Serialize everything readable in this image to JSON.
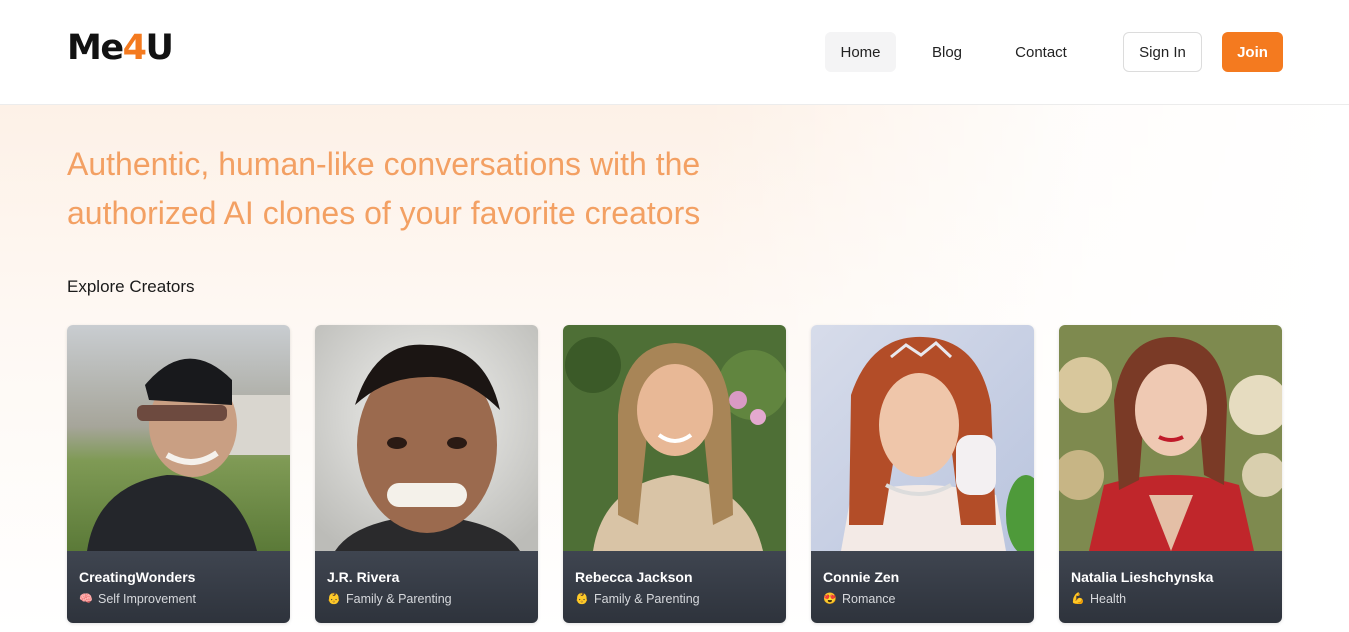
{
  "header": {
    "logo": {
      "prefix": "Me",
      "accent": "4",
      "suffix": "U"
    },
    "nav": {
      "home": "Home",
      "blog": "Blog",
      "contact": "Contact"
    },
    "sign_in": "Sign In",
    "join": "Join"
  },
  "hero": {
    "line1": "Authentic, human-like conversations with the",
    "line2": "authorized AI clones of your favorite creators"
  },
  "section": {
    "title": "Explore Creators"
  },
  "creators": [
    {
      "name": "CreatingWonders",
      "category": "Self Improvement",
      "category_icon": "🧠"
    },
    {
      "name": "J.R. Rivera",
      "category": "Family & Parenting",
      "category_icon": "👶"
    },
    {
      "name": "Rebecca Jackson",
      "category": "Family & Parenting",
      "category_icon": "👶"
    },
    {
      "name": "Connie Zen",
      "category": "Romance",
      "category_icon": "😍"
    },
    {
      "name": "Natalia Lieshchynska",
      "category": "Health",
      "category_icon": "💪"
    }
  ],
  "colors": {
    "accent": "#f47a1f",
    "hero_text": "#f3a063",
    "card_info_bg": "#3a3f49"
  }
}
